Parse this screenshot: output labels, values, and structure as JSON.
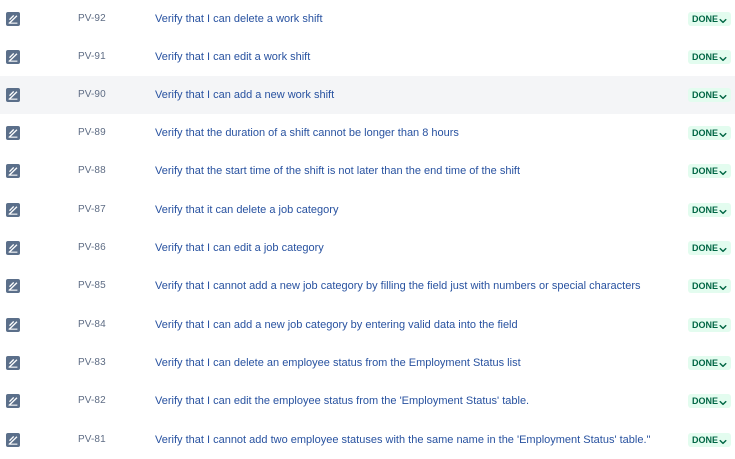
{
  "colors": {
    "status_bg": "#e3fcef",
    "status_text": "#006644",
    "link": "#2852a0",
    "key": "#5e6c84",
    "highlight_row": "#f4f5f7",
    "icon": "#5b6f8a"
  },
  "icons": {
    "issue_type": "test-issue-icon",
    "status_dropdown": "chevron-down-icon"
  },
  "issues": [
    {
      "key": "PV-92",
      "summary": "Verify that I can delete a work shift",
      "status": "DONE"
    },
    {
      "key": "PV-91",
      "summary": "Verify that I can edit a work shift",
      "status": "DONE"
    },
    {
      "key": "PV-90",
      "summary": "Verify that I can add a new work shift",
      "status": "DONE",
      "highlighted": true
    },
    {
      "key": "PV-89",
      "summary": "Verify that the duration of a shift cannot be longer than 8 hours",
      "status": "DONE"
    },
    {
      "key": "PV-88",
      "summary": "Verify that the start time of the shift is not later than the end time of the shift",
      "status": "DONE"
    },
    {
      "key": "PV-87",
      "summary": "Verify that it can delete a job category",
      "status": "DONE"
    },
    {
      "key": "PV-86",
      "summary": "Verify that I can edit a job category",
      "status": "DONE"
    },
    {
      "key": "PV-85",
      "summary": "Verify that I cannot add a new job category by filling the field just with numbers or special characters",
      "status": "DONE"
    },
    {
      "key": "PV-84",
      "summary": "Verify that I can add a new job category by entering valid data into the field",
      "status": "DONE"
    },
    {
      "key": "PV-83",
      "summary": "Verify that I can delete an employee status from the Employment Status list",
      "status": "DONE"
    },
    {
      "key": "PV-82",
      "summary": "Verify that I can edit the employee status from the 'Employment Status' table.",
      "status": "DONE"
    },
    {
      "key": "PV-81",
      "summary": "Verify that I cannot add two employee statuses with the same name in the 'Employment Status' table.\"",
      "status": "DONE"
    }
  ]
}
